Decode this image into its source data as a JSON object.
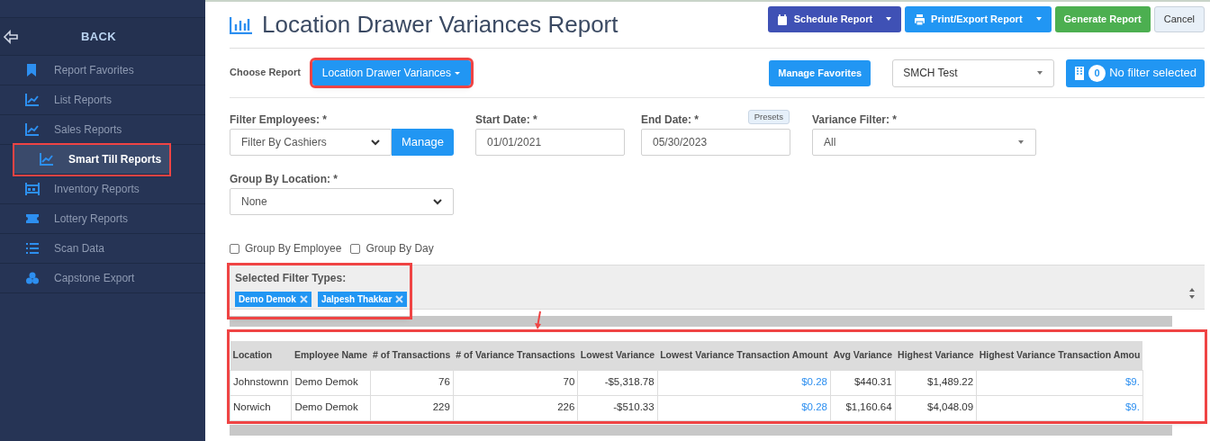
{
  "sidebar": {
    "back_label": "BACK",
    "items": [
      {
        "label": "Report Favorites",
        "selected": false,
        "highlighted": false
      },
      {
        "label": "List Reports",
        "selected": false,
        "highlighted": false
      },
      {
        "label": "Sales Reports",
        "selected": false,
        "highlighted": false
      },
      {
        "label": "Smart Till Reports",
        "selected": true,
        "highlighted": true
      },
      {
        "label": "Inventory Reports",
        "selected": false,
        "highlighted": false
      },
      {
        "label": "Lottery Reports",
        "selected": false,
        "highlighted": false
      },
      {
        "label": "Scan Data",
        "selected": false,
        "highlighted": false
      },
      {
        "label": "Capstone Export",
        "selected": false,
        "highlighted": false
      }
    ]
  },
  "header": {
    "title": "Location Drawer Variances Report",
    "buttons": [
      {
        "kind": "schedule",
        "label": "Schedule Report"
      },
      {
        "kind": "print",
        "label": "Print/Export Report"
      },
      {
        "kind": "generate",
        "label": "Generate Report"
      },
      {
        "kind": "cancel",
        "label": "Cancel"
      }
    ]
  },
  "choose_report": {
    "label": "Choose Report",
    "value": "Location Drawer Variances",
    "highlighted": true,
    "manage_favorites": "Manage Favorites",
    "store": "SMCH Test",
    "filter_count": "0",
    "filter_label": "No filter selected"
  },
  "filters": {
    "employees": {
      "label": "Filter Employees: *",
      "value": "Filter By Cashiers",
      "button": "Manage"
    },
    "start_date": {
      "label": "Start Date: *",
      "value": "01/01/2021"
    },
    "end_date": {
      "label": "End Date: *",
      "value": "05/30/2023",
      "presets": "Presets"
    },
    "variance": {
      "label": "Variance Filter: *",
      "value": "All"
    },
    "group_location": {
      "label": "Group By Location: *",
      "value": "None"
    },
    "checkboxes": [
      {
        "label": "Group By Employee",
        "checked": false
      },
      {
        "label": "Group By Day",
        "checked": false
      }
    ]
  },
  "selected_filters": {
    "title": "Selected Filter Types:",
    "highlighted": true,
    "tags": [
      "Demo Demok",
      "Jalpesh Thakkar"
    ]
  },
  "table": {
    "highlighted": true,
    "columns": [
      "Location",
      "Employee Name",
      "# of Transactions",
      "# of Variance Transactions",
      "Lowest Variance",
      "Lowest Variance Transaction Amount",
      "Avg Variance",
      "Highest Variance",
      "Highest Variance Transaction Amou"
    ],
    "rows": [
      [
        "Johnstownn",
        "Demo Demok",
        "76",
        "70",
        "-$5,318.78",
        "$0.28",
        "$440.31",
        "$1,489.22",
        "$9."
      ],
      [
        "Norwich",
        "Demo Demok",
        "229",
        "226",
        "-$510.33",
        "$0.28",
        "$1,160.64",
        "$4,048.09",
        "$9."
      ]
    ]
  }
}
